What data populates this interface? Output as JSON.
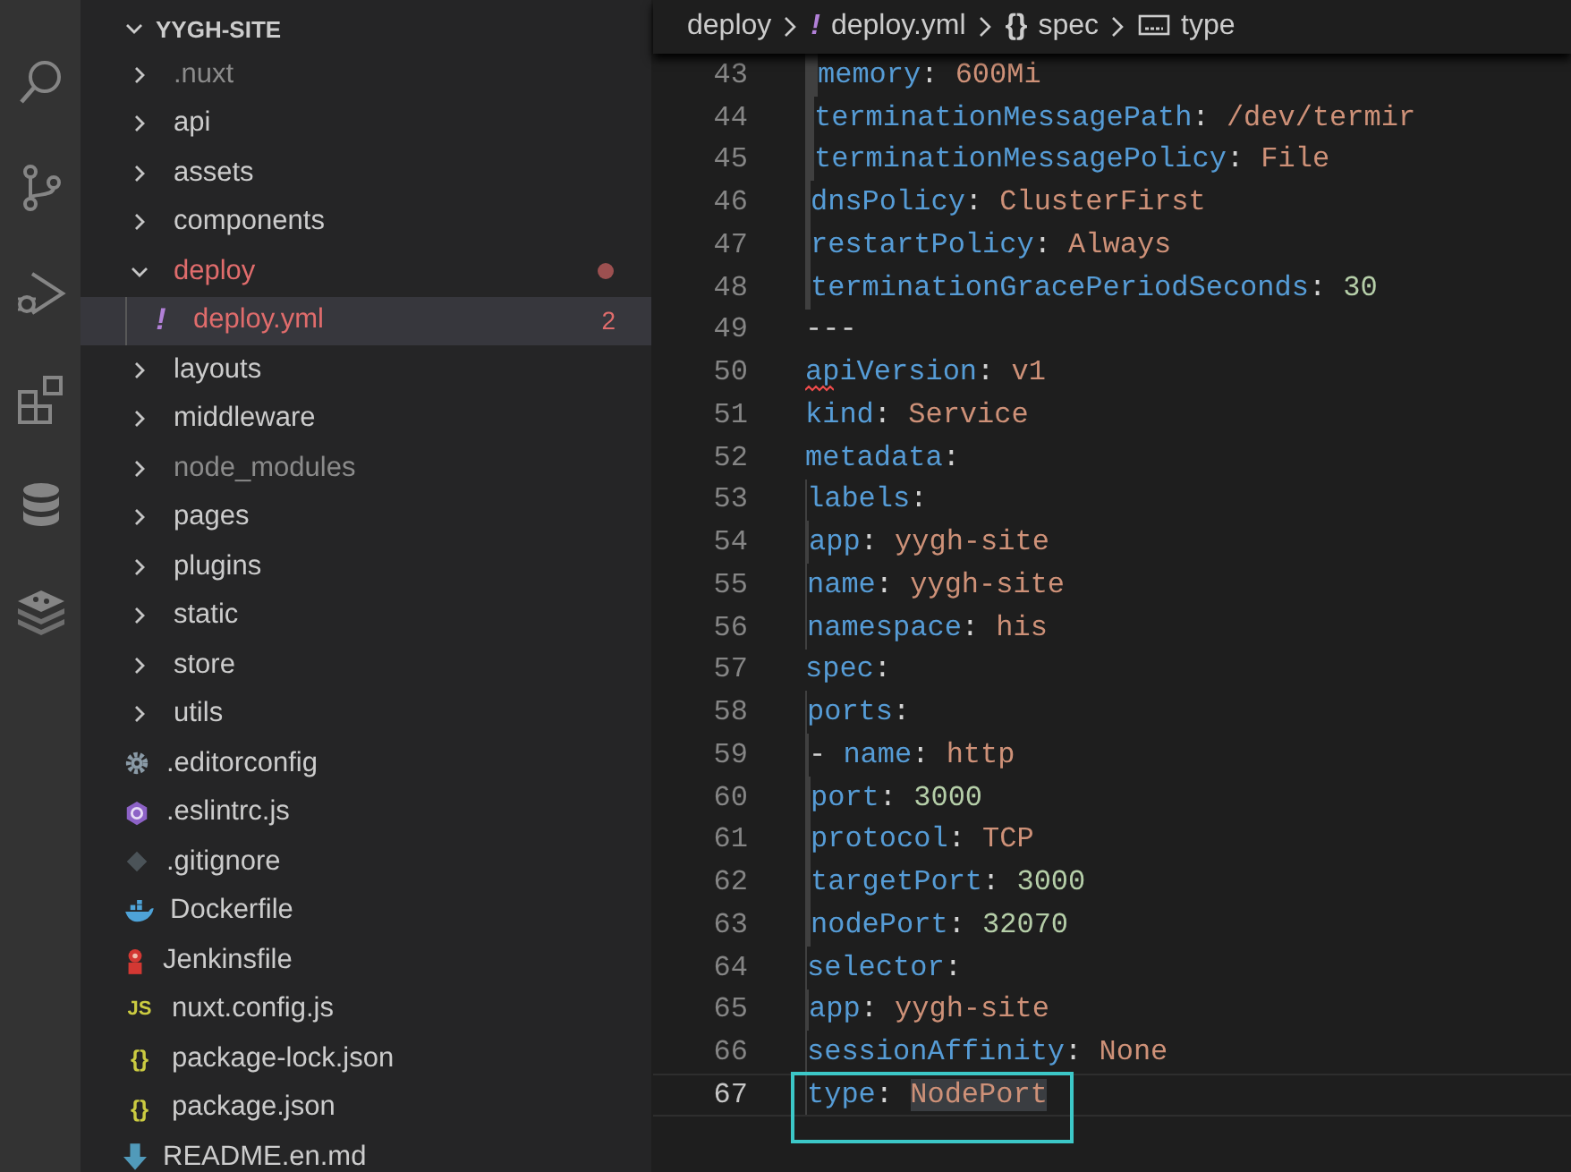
{
  "activity_bar": {
    "items": [
      {
        "kind": "search"
      },
      {
        "kind": "source-control"
      },
      {
        "kind": "debug"
      },
      {
        "kind": "extensions"
      },
      {
        "kind": "database"
      },
      {
        "kind": "stack"
      }
    ]
  },
  "explorer": {
    "title": "YYGH-SITE",
    "expanded": true,
    "items": [
      {
        "name": ".nuxt",
        "kind": "folder",
        "expanded": false,
        "dimmed": true,
        "error": false,
        "selected": false
      },
      {
        "name": "api",
        "kind": "folder",
        "expanded": false,
        "dimmed": false,
        "error": false,
        "selected": false
      },
      {
        "name": "assets",
        "kind": "folder",
        "expanded": false,
        "dimmed": false,
        "error": false,
        "selected": false
      },
      {
        "name": "components",
        "kind": "folder",
        "expanded": false,
        "dimmed": false,
        "error": false,
        "selected": false
      },
      {
        "name": "deploy",
        "kind": "folder",
        "expanded": true,
        "dimmed": false,
        "error": true,
        "selected": false,
        "children": [
          {
            "name": "deploy.yml",
            "kind": "yaml",
            "icon_text": "!",
            "badge": "2",
            "dimmed": false,
            "error": true,
            "selected": true
          }
        ]
      },
      {
        "name": "layouts",
        "kind": "folder",
        "expanded": false,
        "dimmed": false,
        "error": false,
        "selected": false
      },
      {
        "name": "middleware",
        "kind": "folder",
        "expanded": false,
        "dimmed": false,
        "error": false,
        "selected": false
      },
      {
        "name": "node_modules",
        "kind": "folder",
        "expanded": false,
        "dimmed": true,
        "error": false,
        "selected": false
      },
      {
        "name": "pages",
        "kind": "folder",
        "expanded": false,
        "dimmed": false,
        "error": false,
        "selected": false
      },
      {
        "name": "plugins",
        "kind": "folder",
        "expanded": false,
        "dimmed": false,
        "error": false,
        "selected": false
      },
      {
        "name": "static",
        "kind": "folder",
        "expanded": false,
        "dimmed": false,
        "error": false,
        "selected": false
      },
      {
        "name": "store",
        "kind": "folder",
        "expanded": false,
        "dimmed": false,
        "error": false,
        "selected": false
      },
      {
        "name": "utils",
        "kind": "folder",
        "expanded": false,
        "dimmed": false,
        "error": false,
        "selected": false
      },
      {
        "name": ".editorconfig",
        "kind": "config",
        "dimmed": false,
        "error": false,
        "selected": false
      },
      {
        "name": ".eslintrc.js",
        "kind": "eslint",
        "dimmed": false,
        "error": false,
        "selected": false
      },
      {
        "name": ".gitignore",
        "kind": "git",
        "dimmed": false,
        "error": false,
        "selected": false
      },
      {
        "name": "Dockerfile",
        "kind": "docker",
        "dimmed": false,
        "error": false,
        "selected": false
      },
      {
        "name": "Jenkinsfile",
        "kind": "jenkins",
        "dimmed": false,
        "error": false,
        "selected": false
      },
      {
        "name": "nuxt.config.js",
        "kind": "js",
        "icon_text": "JS",
        "dimmed": false,
        "error": false,
        "selected": false
      },
      {
        "name": "package-lock.json",
        "kind": "json",
        "icon_text": "{}",
        "dimmed": false,
        "error": false,
        "selected": false
      },
      {
        "name": "package.json",
        "kind": "json",
        "icon_text": "{}",
        "dimmed": false,
        "error": false,
        "selected": false
      },
      {
        "name": "README.en.md",
        "kind": "markdown",
        "dimmed": false,
        "error": false,
        "selected": false
      }
    ]
  },
  "breadcrumbs": [
    {
      "label": "deploy",
      "kind": "folder"
    },
    {
      "label": "deploy.yml",
      "kind": "yaml",
      "icon_text": "!"
    },
    {
      "label": "spec",
      "kind": "object",
      "icon_text": "{}"
    },
    {
      "label": "type",
      "kind": "string"
    }
  ],
  "editor": {
    "lines": [
      {
        "number": "43",
        "tokens": [
          {
            "text": "              memory",
            "kind": "key"
          },
          {
            "text": ": ",
            "kind": "punct"
          },
          {
            "text": "600Mi",
            "kind": "string"
          }
        ],
        "active": false,
        "error": false,
        "boxed": false
      },
      {
        "number": "44",
        "tokens": [
          {
            "text": "          terminationMessagePath",
            "kind": "key"
          },
          {
            "text": ": ",
            "kind": "punct"
          },
          {
            "text": "/dev/termir",
            "kind": "string"
          }
        ],
        "active": false,
        "error": false,
        "boxed": false
      },
      {
        "number": "45",
        "tokens": [
          {
            "text": "          terminationMessagePolicy",
            "kind": "key"
          },
          {
            "text": ": ",
            "kind": "punct"
          },
          {
            "text": "File",
            "kind": "string"
          }
        ],
        "active": false,
        "error": false,
        "boxed": false
      },
      {
        "number": "46",
        "tokens": [
          {
            "text": "      dnsPolicy",
            "kind": "key"
          },
          {
            "text": ": ",
            "kind": "punct"
          },
          {
            "text": "ClusterFirst",
            "kind": "string"
          }
        ],
        "active": false,
        "error": false,
        "boxed": false
      },
      {
        "number": "47",
        "tokens": [
          {
            "text": "      restartPolicy",
            "kind": "key"
          },
          {
            "text": ": ",
            "kind": "punct"
          },
          {
            "text": "Always",
            "kind": "string"
          }
        ],
        "active": false,
        "error": false,
        "boxed": false
      },
      {
        "number": "48",
        "tokens": [
          {
            "text": "      terminationGracePeriodSeconds",
            "kind": "key"
          },
          {
            "text": ": ",
            "kind": "punct"
          },
          {
            "text": "30",
            "kind": "number"
          }
        ],
        "active": false,
        "error": false,
        "boxed": false
      },
      {
        "number": "49",
        "tokens": [
          {
            "text": "---",
            "kind": "punct"
          }
        ],
        "active": false,
        "error": false,
        "boxed": false
      },
      {
        "number": "50",
        "tokens": [
          {
            "text": "apiVersion",
            "kind": "key"
          },
          {
            "text": ": ",
            "kind": "punct"
          },
          {
            "text": "v1",
            "kind": "string"
          }
        ],
        "active": false,
        "error": true,
        "boxed": false
      },
      {
        "number": "51",
        "tokens": [
          {
            "text": "kind",
            "kind": "key"
          },
          {
            "text": ": ",
            "kind": "punct"
          },
          {
            "text": "Service",
            "kind": "string"
          }
        ],
        "active": false,
        "error": false,
        "boxed": false
      },
      {
        "number": "52",
        "tokens": [
          {
            "text": "metadata",
            "kind": "key"
          },
          {
            "text": ":",
            "kind": "punct"
          }
        ],
        "active": false,
        "error": false,
        "boxed": false
      },
      {
        "number": "53",
        "tokens": [
          {
            "text": "  labels",
            "kind": "key"
          },
          {
            "text": ":",
            "kind": "punct"
          }
        ],
        "active": false,
        "error": false,
        "boxed": false
      },
      {
        "number": "54",
        "tokens": [
          {
            "text": "    app",
            "kind": "key"
          },
          {
            "text": ": ",
            "kind": "punct"
          },
          {
            "text": "yygh-site",
            "kind": "string"
          }
        ],
        "active": false,
        "error": false,
        "boxed": false
      },
      {
        "number": "55",
        "tokens": [
          {
            "text": "  name",
            "kind": "key"
          },
          {
            "text": ": ",
            "kind": "punct"
          },
          {
            "text": "yygh-site",
            "kind": "string"
          }
        ],
        "active": false,
        "error": false,
        "boxed": false
      },
      {
        "number": "56",
        "tokens": [
          {
            "text": "  namespace",
            "kind": "key"
          },
          {
            "text": ": ",
            "kind": "punct"
          },
          {
            "text": "his",
            "kind": "string"
          }
        ],
        "active": false,
        "error": false,
        "boxed": false
      },
      {
        "number": "57",
        "tokens": [
          {
            "text": "spec",
            "kind": "key"
          },
          {
            "text": ":",
            "kind": "punct"
          }
        ],
        "active": false,
        "error": false,
        "boxed": false
      },
      {
        "number": "58",
        "tokens": [
          {
            "text": "  ports",
            "kind": "key"
          },
          {
            "text": ":",
            "kind": "punct"
          }
        ],
        "active": false,
        "error": false,
        "boxed": false
      },
      {
        "number": "59",
        "tokens": [
          {
            "text": "    - ",
            "kind": "punct"
          },
          {
            "text": "name",
            "kind": "key"
          },
          {
            "text": ": ",
            "kind": "punct"
          },
          {
            "text": "http",
            "kind": "string"
          }
        ],
        "active": false,
        "error": false,
        "boxed": false
      },
      {
        "number": "60",
        "tokens": [
          {
            "text": "      port",
            "kind": "key"
          },
          {
            "text": ": ",
            "kind": "punct"
          },
          {
            "text": "3000",
            "kind": "number"
          }
        ],
        "active": false,
        "error": false,
        "boxed": false
      },
      {
        "number": "61",
        "tokens": [
          {
            "text": "      protocol",
            "kind": "key"
          },
          {
            "text": ": ",
            "kind": "punct"
          },
          {
            "text": "TCP",
            "kind": "string"
          }
        ],
        "active": false,
        "error": false,
        "boxed": false
      },
      {
        "number": "62",
        "tokens": [
          {
            "text": "      targetPort",
            "kind": "key"
          },
          {
            "text": ": ",
            "kind": "punct"
          },
          {
            "text": "3000",
            "kind": "number"
          }
        ],
        "active": false,
        "error": false,
        "boxed": false
      },
      {
        "number": "63",
        "tokens": [
          {
            "text": "      nodePort",
            "kind": "key"
          },
          {
            "text": ": ",
            "kind": "punct"
          },
          {
            "text": "32070",
            "kind": "number"
          }
        ],
        "active": false,
        "error": false,
        "boxed": false
      },
      {
        "number": "64",
        "tokens": [
          {
            "text": "  selector",
            "kind": "key"
          },
          {
            "text": ":",
            "kind": "punct"
          }
        ],
        "active": false,
        "error": false,
        "boxed": false
      },
      {
        "number": "65",
        "tokens": [
          {
            "text": "    app",
            "kind": "key"
          },
          {
            "text": ": ",
            "kind": "punct"
          },
          {
            "text": "yygh-site",
            "kind": "string"
          }
        ],
        "active": false,
        "error": false,
        "boxed": false
      },
      {
        "number": "66",
        "tokens": [
          {
            "text": "  sessionAffinity",
            "kind": "key"
          },
          {
            "text": ": ",
            "kind": "punct"
          },
          {
            "text": "None",
            "kind": "string"
          }
        ],
        "active": false,
        "error": false,
        "boxed": false
      },
      {
        "number": "67",
        "tokens": [
          {
            "text": "  type",
            "kind": "key"
          },
          {
            "text": ": ",
            "kind": "punct"
          },
          {
            "text": "NodePort",
            "kind": "match"
          }
        ],
        "active": true,
        "error": false,
        "boxed": true
      }
    ]
  }
}
